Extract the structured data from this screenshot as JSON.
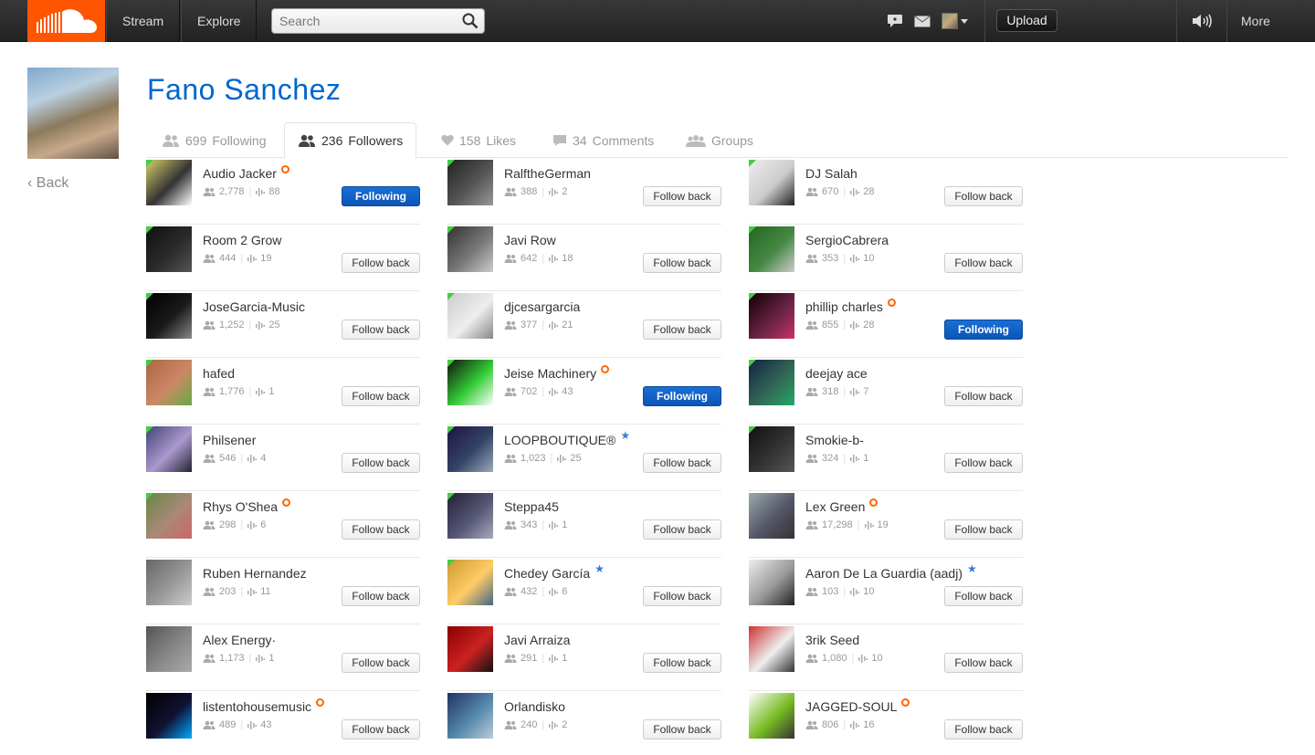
{
  "header": {
    "nav": [
      "Stream",
      "Explore"
    ],
    "search_placeholder": "Search",
    "upload_label": "Upload",
    "more_label": "More"
  },
  "profile": {
    "name": "Fano Sanchez",
    "back_label": "Back"
  },
  "tabs": [
    {
      "count": "699",
      "label": "Following"
    },
    {
      "count": "236",
      "label": "Followers"
    },
    {
      "count": "158",
      "label": "Likes"
    },
    {
      "count": "34",
      "label": "Comments"
    },
    {
      "count": "",
      "label": "Groups"
    }
  ],
  "colors": {
    "brand": "#ff5500",
    "link": "#0066cc",
    "following": "#0b55b5",
    "new_flag": "#44cc44"
  },
  "followers": [
    {
      "name": "Audio Jacker",
      "badge": "pro",
      "followers": "2,778",
      "tracks": "88",
      "button": "Following"
    },
    {
      "name": "Room 2 Grow",
      "badge": "",
      "followers": "444",
      "tracks": "19",
      "button": "Follow back"
    },
    {
      "name": "JoseGarcia-Music",
      "badge": "",
      "followers": "1,252",
      "tracks": "25",
      "button": "Follow back"
    },
    {
      "name": "hafed",
      "badge": "",
      "followers": "1,776",
      "tracks": "1",
      "button": "Follow back"
    },
    {
      "name": "Philsener",
      "badge": "",
      "followers": "546",
      "tracks": "4",
      "button": "Follow back"
    },
    {
      "name": "Rhys O'Shea",
      "badge": "pro",
      "followers": "298",
      "tracks": "6",
      "button": "Follow back"
    },
    {
      "name": "Ruben Hernandez",
      "badge": "",
      "followers": "203",
      "tracks": "11",
      "button": "Follow back"
    },
    {
      "name": "Alex Energy·",
      "badge": "",
      "followers": "1,173",
      "tracks": "1",
      "button": "Follow back"
    },
    {
      "name": "listentohousemusic",
      "badge": "pro",
      "followers": "489",
      "tracks": "43",
      "button": "Follow back"
    },
    {
      "name": "RalftheGerman",
      "badge": "",
      "followers": "388",
      "tracks": "2",
      "button": "Follow back"
    },
    {
      "name": "Javi Row",
      "badge": "",
      "followers": "642",
      "tracks": "18",
      "button": "Follow back"
    },
    {
      "name": "djcesargarcia",
      "badge": "",
      "followers": "377",
      "tracks": "21",
      "button": "Follow back"
    },
    {
      "name": "Jeise Machinery",
      "badge": "pro",
      "followers": "702",
      "tracks": "43",
      "button": "Following"
    },
    {
      "name": "LOOPBOUTIQUE®",
      "badge": "star",
      "followers": "1,023",
      "tracks": "25",
      "button": "Follow back"
    },
    {
      "name": "Steppa45",
      "badge": "",
      "followers": "343",
      "tracks": "1",
      "button": "Follow back"
    },
    {
      "name": "Chedey García",
      "badge": "star",
      "followers": "432",
      "tracks": "6",
      "button": "Follow back"
    },
    {
      "name": "Javi Arraiza",
      "badge": "",
      "followers": "291",
      "tracks": "1",
      "button": "Follow back"
    },
    {
      "name": "Orlandisko",
      "badge": "",
      "followers": "240",
      "tracks": "2",
      "button": "Follow back"
    },
    {
      "name": "DJ Salah",
      "badge": "",
      "followers": "670",
      "tracks": "28",
      "button": "Follow back"
    },
    {
      "name": "SergioCabrera",
      "badge": "",
      "followers": "353",
      "tracks": "10",
      "button": "Follow back"
    },
    {
      "name": "phillip charles",
      "badge": "pro",
      "followers": "855",
      "tracks": "28",
      "button": "Following"
    },
    {
      "name": "deejay ace",
      "badge": "",
      "followers": "318",
      "tracks": "7",
      "button": "Follow back"
    },
    {
      "name": "Smokie-b-",
      "badge": "",
      "followers": "324",
      "tracks": "1",
      "button": "Follow back"
    },
    {
      "name": "Lex Green",
      "badge": "pro",
      "followers": "17,298",
      "tracks": "19",
      "button": "Follow back"
    },
    {
      "name": "Aaron De La Guardia (aadj)",
      "badge": "star",
      "followers": "103",
      "tracks": "10",
      "button": "Follow back"
    },
    {
      "name": "3rik Seed",
      "badge": "",
      "followers": "1,080",
      "tracks": "10",
      "button": "Follow back"
    },
    {
      "name": "JAGGED-SOUL",
      "badge": "pro",
      "followers": "806",
      "tracks": "16",
      "button": "Follow back"
    }
  ]
}
